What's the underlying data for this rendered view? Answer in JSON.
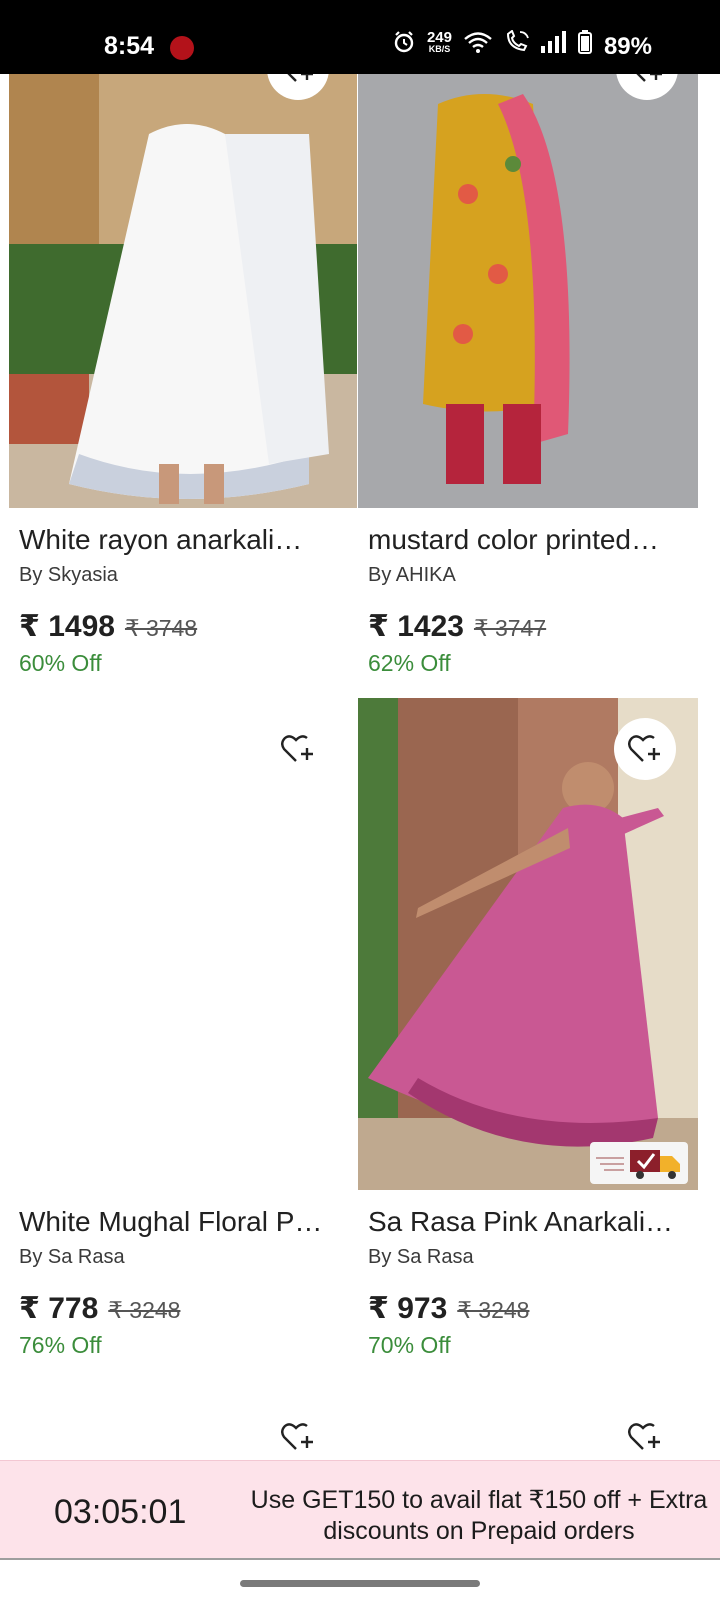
{
  "status_bar": {
    "time": "8:54",
    "net_speed": "249",
    "net_unit": "KB/S",
    "battery": "89%",
    "icons": [
      "alarm-icon",
      "wifi-icon",
      "wifi-call-icon",
      "signal-icon",
      "battery-icon"
    ]
  },
  "products": [
    {
      "title": "White rayon anarkali…",
      "brand": "By Skyasia",
      "price": "₹ 1498",
      "mrp": "₹ 3748",
      "discount": "60% Off"
    },
    {
      "title": "mustard color printed…",
      "brand": "By AHIKA",
      "price": "₹ 1423",
      "mrp": "₹ 3747",
      "discount": "62% Off"
    },
    {
      "title": "White Mughal Floral P…",
      "brand": "By Sa Rasa",
      "price": "₹ 778",
      "mrp": "₹ 3248",
      "discount": "76% Off"
    },
    {
      "title": "Sa Rasa Pink Anarkali…",
      "brand": "By Sa Rasa",
      "price": "₹ 973",
      "mrp": "₹ 3248",
      "discount": "70% Off"
    }
  ],
  "promo": {
    "timer": "03:05:01",
    "message": "Use GET150 to avail flat ₹150 off + Extra discounts on Prepaid orders"
  },
  "colors": {
    "discount_green": "#3b8d3b",
    "promo_bg": "#fde3ea"
  }
}
